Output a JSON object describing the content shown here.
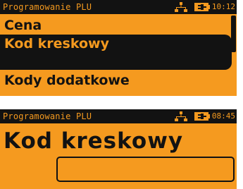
{
  "screens": [
    {
      "status": {
        "title": "Programowanie PLU",
        "time": "10:12"
      },
      "menu": {
        "items": [
          "Cena",
          "Kod kreskowy",
          "Kody dodatkowe"
        ],
        "selected": "Kod kreskowy"
      }
    },
    {
      "status": {
        "title": "Programowanie PLU",
        "time": "08:45"
      },
      "title": "Kod kreskowy",
      "barcode": {
        "value": ""
      }
    }
  ],
  "colors": {
    "lcd_background": "#f59a1f",
    "lcd_ink": "#121212"
  },
  "icons": {
    "network": "network-icon",
    "battery": "battery-plug-icon"
  }
}
